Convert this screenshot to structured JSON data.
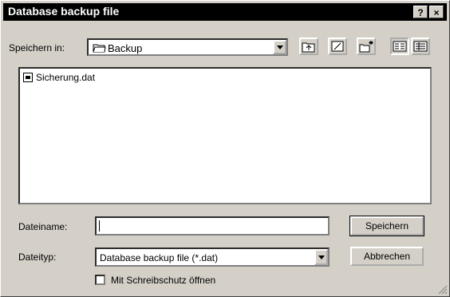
{
  "window": {
    "title": "Database backup file"
  },
  "titlebar": {
    "help_label": "?",
    "close_label": "×"
  },
  "location": {
    "label": "Speichern in:",
    "value": "Backup"
  },
  "files": [
    {
      "name": "Sicherung.dat"
    }
  ],
  "filename": {
    "label": "Dateiname:",
    "value": ""
  },
  "filetype": {
    "label": "Dateityp:",
    "value": "Database backup file (*.dat)"
  },
  "buttons": {
    "save": "Speichern",
    "cancel": "Abbrechen"
  },
  "readonly_checkbox": {
    "label": "Mit Schreibschutz öffnen",
    "checked": false
  },
  "icons": {
    "folder": "folder-icon",
    "up": "up-one-level-icon",
    "desktop": "desktop-icon",
    "new_folder": "new-folder-icon",
    "list_view": "list-view-icon",
    "details_view": "details-view-icon"
  }
}
